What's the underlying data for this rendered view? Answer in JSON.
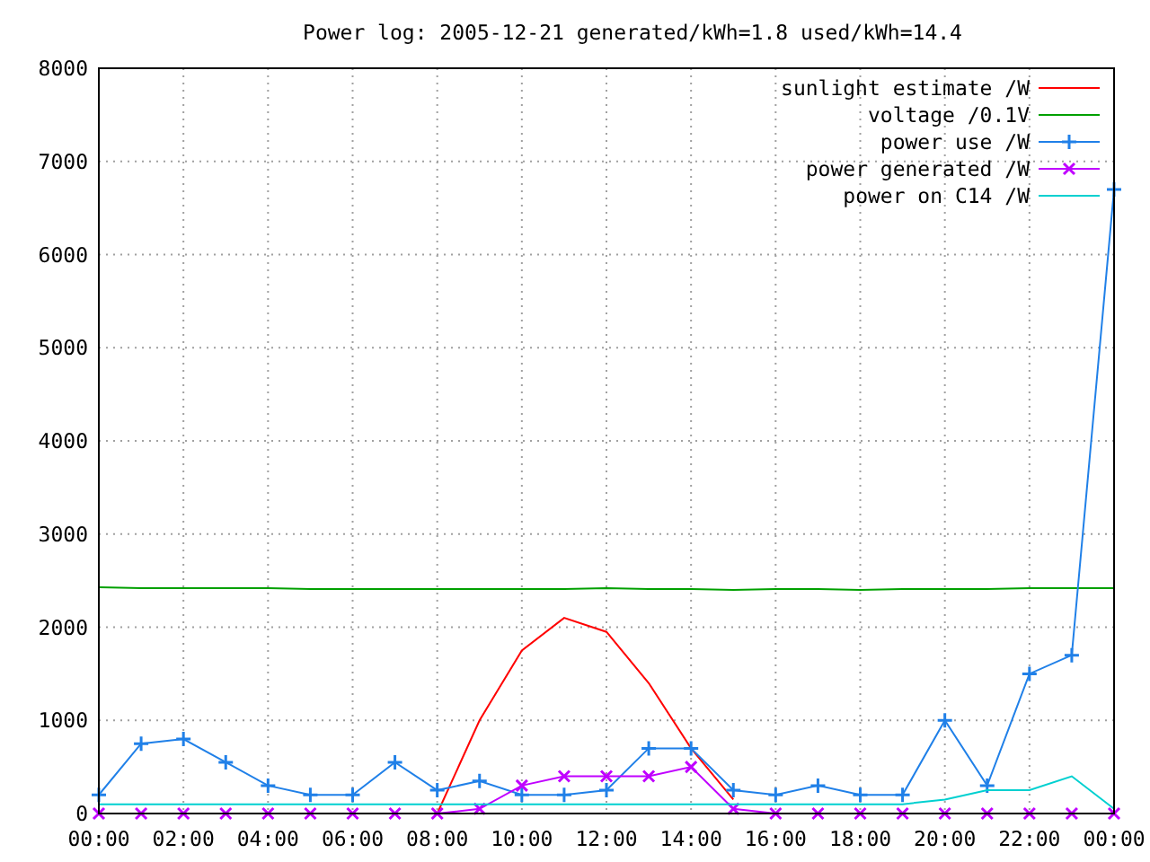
{
  "chart_data": {
    "type": "line",
    "title": "Power log: 2005-12-21 generated/kWh=1.8 used/kWh=14.4",
    "x": [
      0,
      1,
      2,
      3,
      4,
      5,
      6,
      7,
      8,
      9,
      10,
      11,
      12,
      13,
      14,
      15,
      16,
      17,
      18,
      19,
      20,
      21,
      22,
      23,
      24
    ],
    "xlim": [
      0,
      24
    ],
    "ylim": [
      0,
      8000
    ],
    "grid": true,
    "legend": true,
    "xticks": [
      {
        "value": 0,
        "label": "00:00"
      },
      {
        "value": 2,
        "label": "02:00"
      },
      {
        "value": 4,
        "label": "04:00"
      },
      {
        "value": 6,
        "label": "06:00"
      },
      {
        "value": 8,
        "label": "08:00"
      },
      {
        "value": 10,
        "label": "10:00"
      },
      {
        "value": 12,
        "label": "12:00"
      },
      {
        "value": 14,
        "label": "14:00"
      },
      {
        "value": 16,
        "label": "16:00"
      },
      {
        "value": 18,
        "label": "18:00"
      },
      {
        "value": 20,
        "label": "20:00"
      },
      {
        "value": 22,
        "label": "22:00"
      },
      {
        "value": 24,
        "label": "00:00"
      }
    ],
    "yticks": [
      0,
      1000,
      2000,
      3000,
      4000,
      5000,
      6000,
      7000,
      8000
    ],
    "series": [
      {
        "name": "sunlight estimate /W",
        "color": "#ff0000",
        "marker": "none",
        "values": [
          null,
          null,
          null,
          null,
          null,
          null,
          null,
          null,
          0,
          1000,
          1750,
          2100,
          1950,
          1400,
          700,
          150,
          null,
          null,
          null,
          null,
          null,
          null,
          null,
          null,
          null
        ]
      },
      {
        "name": "voltage /0.1V",
        "color": "#00a000",
        "marker": "none",
        "values": [
          2430,
          2420,
          2420,
          2420,
          2420,
          2410,
          2410,
          2410,
          2410,
          2410,
          2410,
          2410,
          2420,
          2410,
          2410,
          2400,
          2410,
          2410,
          2400,
          2410,
          2410,
          2410,
          2420,
          2420,
          2420
        ]
      },
      {
        "name": "power use /W",
        "color": "#2080e8",
        "marker": "plus",
        "values": [
          200,
          750,
          800,
          550,
          300,
          200,
          200,
          550,
          250,
          350,
          200,
          200,
          250,
          700,
          700,
          250,
          200,
          300,
          200,
          200,
          1000,
          300,
          1500,
          1700,
          6700
        ]
      },
      {
        "name": "power generated /W",
        "color": "#c000ff",
        "marker": "cross",
        "values": [
          0,
          0,
          0,
          0,
          0,
          0,
          0,
          0,
          0,
          50,
          300,
          400,
          400,
          400,
          500,
          50,
          0,
          0,
          0,
          0,
          0,
          0,
          0,
          0,
          0
        ]
      },
      {
        "name": "power on C14 /W",
        "color": "#00d0d0",
        "marker": "none",
        "values": [
          100,
          100,
          100,
          100,
          100,
          100,
          100,
          100,
          100,
          100,
          100,
          100,
          100,
          100,
          100,
          100,
          100,
          100,
          100,
          100,
          150,
          250,
          250,
          400,
          50
        ]
      }
    ]
  }
}
